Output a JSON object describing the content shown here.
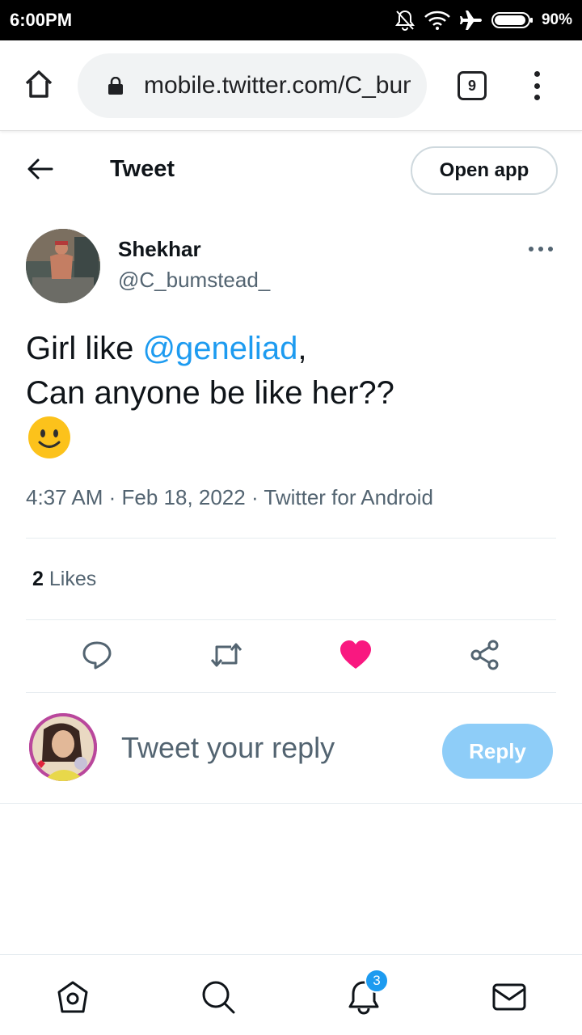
{
  "status_bar": {
    "time": "6:00PM",
    "battery": "90%",
    "icons": [
      "bell-off-icon",
      "wifi-icon",
      "airplane-icon",
      "battery-icon"
    ]
  },
  "browser": {
    "url": "mobile.twitter.com/C_bumstead_",
    "tab_count": "9",
    "icons": [
      "home-icon",
      "lock-icon",
      "tabs-icon",
      "more-vert-icon"
    ]
  },
  "header": {
    "title": "Tweet",
    "open_app_label": "Open app"
  },
  "tweet": {
    "author_name": "Shekhar",
    "author_handle": "@C_bumstead_",
    "text_prefix": "Girl like ",
    "mention": "@geneliad",
    "text_after_mention": ",",
    "text_line2": "Can anyone be like her??",
    "emoji": "slightly-smiling-face",
    "meta": "4:37 AM · Feb 18, 2022 · Twitter for Android",
    "likes_count": "2",
    "likes_label": "Likes",
    "liked": true
  },
  "actions": [
    "reply-icon",
    "retweet-icon",
    "like-icon",
    "share-icon"
  ],
  "reply": {
    "placeholder": "Tweet your reply",
    "button_label": "Reply"
  },
  "bottom_nav": {
    "items": [
      "home-icon",
      "search-icon",
      "notifications-icon",
      "messages-icon"
    ],
    "notification_count": "3"
  },
  "colors": {
    "accent": "#1d9bf0",
    "like": "#f91880",
    "reply_button_disabled": "#8ecdf8",
    "secondary_text": "#536471"
  }
}
